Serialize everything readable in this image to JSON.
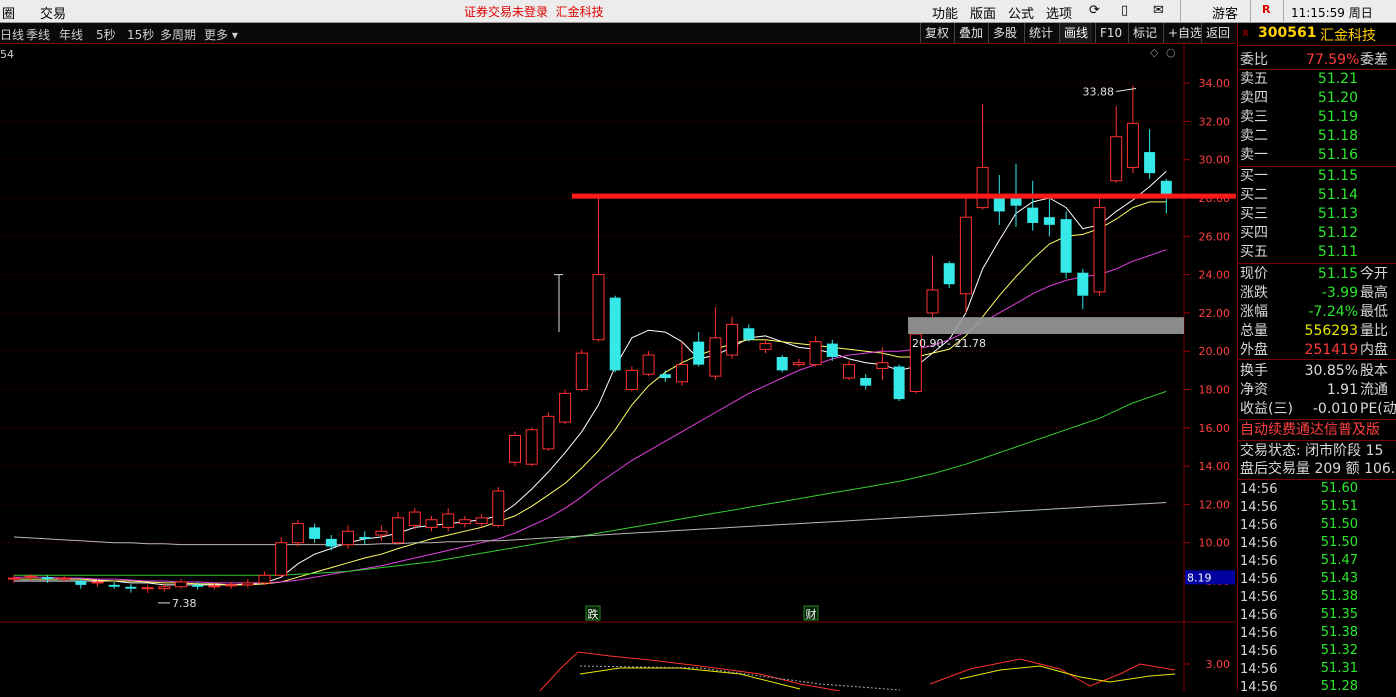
{
  "menubar": {
    "left_items": [
      "圈",
      "交易"
    ],
    "notice": "证券交易未登录",
    "stock_name": "汇金科技",
    "menus": [
      "功能",
      "版面",
      "公式",
      "选项"
    ],
    "user": "游客",
    "r_badge": "R",
    "time": "11:15:59",
    "weekday": "周日"
  },
  "toolbar": {
    "periods": [
      "日线",
      "季线",
      "年线",
      "5秒",
      "15秒",
      "多周期",
      "更多 ▾"
    ],
    "buttons": [
      "复权",
      "叠加",
      "多股",
      "统计",
      "画线",
      "F10",
      "标记",
      "+自选",
      "返回"
    ]
  },
  "chart": {
    "corner_label": "54",
    "max_label": "33.88",
    "min_label": "7.38",
    "zone_label": "20.90 - 21.78",
    "current_marker": "8.19",
    "sub_tick": "3.00",
    "event_markers": [
      {
        "label": "跌"
      },
      {
        "label": "财"
      }
    ]
  },
  "chart_data": {
    "type": "candlestick",
    "yticks": [
      8,
      10,
      12,
      14,
      16,
      18,
      20,
      22,
      24,
      26,
      28,
      30,
      32,
      34
    ],
    "ylim": [
      6.8,
      35
    ],
    "ytick_labels": [
      "8.00",
      "10.00",
      "12.00",
      "14.00",
      "16.00",
      "18.00",
      "20.00",
      "22.00",
      "24.00",
      "26.00",
      "28.00",
      "30.00",
      "32.00",
      "34.00"
    ],
    "candles": [
      {
        "o": 8.1,
        "c": 8.15,
        "h": 8.3,
        "l": 7.9
      },
      {
        "o": 8.2,
        "c": 8.25,
        "h": 8.35,
        "l": 8.0
      },
      {
        "o": 8.2,
        "c": 8.1,
        "h": 8.3,
        "l": 7.9
      },
      {
        "o": 8.1,
        "c": 8.15,
        "h": 8.25,
        "l": 7.95
      },
      {
        "o": 8.0,
        "c": 7.8,
        "h": 8.1,
        "l": 7.6
      },
      {
        "o": 7.9,
        "c": 7.95,
        "h": 8.05,
        "l": 7.7
      },
      {
        "o": 7.8,
        "c": 7.7,
        "h": 7.95,
        "l": 7.6
      },
      {
        "o": 7.7,
        "c": 7.6,
        "h": 7.85,
        "l": 7.4
      },
      {
        "o": 7.6,
        "c": 7.65,
        "h": 7.8,
        "l": 7.38
      },
      {
        "o": 7.6,
        "c": 7.7,
        "h": 7.85,
        "l": 7.45
      },
      {
        "o": 7.7,
        "c": 7.95,
        "h": 8.1,
        "l": 7.6
      },
      {
        "o": 7.8,
        "c": 7.7,
        "h": 7.95,
        "l": 7.55
      },
      {
        "o": 7.7,
        "c": 7.75,
        "h": 7.9,
        "l": 7.55
      },
      {
        "o": 7.75,
        "c": 7.8,
        "h": 7.95,
        "l": 7.6
      },
      {
        "o": 7.8,
        "c": 7.9,
        "h": 8.1,
        "l": 7.65
      },
      {
        "o": 7.9,
        "c": 8.3,
        "h": 8.5,
        "l": 7.8
      },
      {
        "o": 8.3,
        "c": 10.0,
        "h": 10.3,
        "l": 8.2
      },
      {
        "o": 10.0,
        "c": 11.0,
        "h": 11.2,
        "l": 9.8
      },
      {
        "o": 10.8,
        "c": 10.2,
        "h": 11.0,
        "l": 10.0
      },
      {
        "o": 10.2,
        "c": 9.8,
        "h": 10.4,
        "l": 9.6
      },
      {
        "o": 9.9,
        "c": 10.6,
        "h": 10.9,
        "l": 9.7
      },
      {
        "o": 10.3,
        "c": 10.2,
        "h": 10.6,
        "l": 9.9
      },
      {
        "o": 10.4,
        "c": 10.6,
        "h": 10.9,
        "l": 10.1
      },
      {
        "o": 10.0,
        "c": 11.3,
        "h": 11.6,
        "l": 9.9
      },
      {
        "o": 10.9,
        "c": 11.6,
        "h": 11.8,
        "l": 10.7
      },
      {
        "o": 10.8,
        "c": 11.2,
        "h": 11.4,
        "l": 10.6
      },
      {
        "o": 10.8,
        "c": 11.5,
        "h": 11.8,
        "l": 10.6
      },
      {
        "o": 11.0,
        "c": 11.2,
        "h": 11.4,
        "l": 10.8
      },
      {
        "o": 11.0,
        "c": 11.3,
        "h": 11.5,
        "l": 10.8
      },
      {
        "o": 10.9,
        "c": 12.7,
        "h": 12.9,
        "l": 10.8
      },
      {
        "o": 14.2,
        "c": 15.6,
        "h": 15.8,
        "l": 14.0
      },
      {
        "o": 14.1,
        "c": 15.9,
        "h": 16.0,
        "l": 14.0
      },
      {
        "o": 14.9,
        "c": 16.6,
        "h": 16.8,
        "l": 14.8
      },
      {
        "o": 16.3,
        "c": 17.8,
        "h": 18.0,
        "l": 16.2
      },
      {
        "o": 18.0,
        "c": 19.9,
        "h": 20.1,
        "l": 17.9
      },
      {
        "o": 20.6,
        "c": 24.0,
        "h": 28.0,
        "l": 20.5
      },
      {
        "o": 22.8,
        "c": 19.0,
        "h": 22.9,
        "l": 18.9
      },
      {
        "o": 18.0,
        "c": 19.0,
        "h": 19.2,
        "l": 17.9
      },
      {
        "o": 18.8,
        "c": 19.8,
        "h": 20.0,
        "l": 18.7
      },
      {
        "o": 18.8,
        "c": 18.6,
        "h": 19.0,
        "l": 18.4
      },
      {
        "o": 18.4,
        "c": 19.3,
        "h": 20.5,
        "l": 18.2
      },
      {
        "o": 20.5,
        "c": 19.3,
        "h": 21.0,
        "l": 19.2
      },
      {
        "o": 18.7,
        "c": 20.7,
        "h": 22.3,
        "l": 18.5
      },
      {
        "o": 19.8,
        "c": 21.4,
        "h": 21.8,
        "l": 19.6
      },
      {
        "o": 21.2,
        "c": 20.6,
        "h": 21.4,
        "l": 20.5
      },
      {
        "o": 20.1,
        "c": 20.4,
        "h": 20.6,
        "l": 19.9
      },
      {
        "o": 19.7,
        "c": 19.0,
        "h": 19.8,
        "l": 18.9
      },
      {
        "o": 19.3,
        "c": 19.4,
        "h": 19.6,
        "l": 19.2
      },
      {
        "o": 19.3,
        "c": 20.5,
        "h": 20.8,
        "l": 19.2
      },
      {
        "o": 20.4,
        "c": 19.7,
        "h": 20.6,
        "l": 19.5
      },
      {
        "o": 18.6,
        "c": 19.3,
        "h": 19.5,
        "l": 18.5
      },
      {
        "o": 18.6,
        "c": 18.2,
        "h": 18.8,
        "l": 18.0
      },
      {
        "o": 19.1,
        "c": 19.4,
        "h": 20.2,
        "l": 18.5
      },
      {
        "o": 19.2,
        "c": 17.5,
        "h": 19.3,
        "l": 17.4
      },
      {
        "o": 17.9,
        "c": 20.9,
        "h": 21.0,
        "l": 17.8
      },
      {
        "o": 22.0,
        "c": 23.2,
        "h": 25.0,
        "l": 21.8
      },
      {
        "o": 24.6,
        "c": 23.5,
        "h": 24.7,
        "l": 23.3
      },
      {
        "o": 23.0,
        "c": 27.0,
        "h": 28.1,
        "l": 22.0
      },
      {
        "o": 27.5,
        "c": 29.6,
        "h": 32.9,
        "l": 27.4
      },
      {
        "o": 28.1,
        "c": 27.3,
        "h": 29.2,
        "l": 26.6
      },
      {
        "o": 28.1,
        "c": 27.6,
        "h": 29.8,
        "l": 26.5
      },
      {
        "o": 27.5,
        "c": 26.7,
        "h": 28.9,
        "l": 26.3
      },
      {
        "o": 27.0,
        "c": 26.6,
        "h": 28.2,
        "l": 26.0
      },
      {
        "o": 26.9,
        "c": 24.1,
        "h": 27.3,
        "l": 23.8
      },
      {
        "o": 24.1,
        "c": 22.9,
        "h": 24.3,
        "l": 22.2
      },
      {
        "o": 23.1,
        "c": 27.5,
        "h": 28.1,
        "l": 22.9
      },
      {
        "o": 28.9,
        "c": 31.2,
        "h": 32.8,
        "l": 28.8
      },
      {
        "o": 29.6,
        "c": 31.9,
        "h": 33.88,
        "l": 29.3
      },
      {
        "o": 30.4,
        "c": 29.3,
        "h": 31.6,
        "l": 29.0
      },
      {
        "o": 28.9,
        "c": 28.1,
        "h": 29.0,
        "l": 27.2
      }
    ],
    "resistance_level": 28.1,
    "zone": [
      20.9,
      21.78
    ],
    "ma_lines": [
      {
        "color": "#ffffff",
        "values": [
          8.0,
          8.0,
          8.0,
          8.0,
          8.0,
          8.0,
          8.0,
          7.9,
          7.9,
          7.8,
          7.8,
          7.8,
          7.8,
          7.8,
          7.85,
          7.9,
          8.2,
          8.9,
          9.4,
          9.7,
          10.0,
          10.2,
          10.3,
          10.5,
          10.8,
          10.9,
          11.0,
          11.1,
          11.2,
          11.4,
          12.0,
          12.8,
          13.7,
          14.7,
          15.8,
          17.2,
          19.2,
          20.7,
          21.1,
          21.0,
          20.5,
          19.6,
          19.8,
          20.2,
          20.7,
          20.8,
          20.5,
          20.2,
          20.1,
          19.9,
          19.6,
          19.4,
          19.3,
          19.0,
          19.2,
          19.9,
          20.6,
          22.0,
          24.3,
          25.8,
          27.2,
          27.8,
          28.0,
          27.5,
          26.4,
          26.6,
          27.3,
          27.9,
          28.6,
          29.4
        ]
      },
      {
        "color": "#ffff66",
        "values": [
          8.1,
          8.1,
          8.1,
          8.1,
          8.1,
          8.05,
          8.0,
          8.0,
          7.95,
          7.9,
          7.9,
          7.85,
          7.85,
          7.8,
          7.8,
          7.85,
          7.95,
          8.2,
          8.45,
          8.7,
          8.95,
          9.2,
          9.4,
          9.7,
          9.95,
          10.2,
          10.4,
          10.6,
          10.8,
          11.1,
          11.4,
          11.9,
          12.5,
          13.1,
          13.9,
          14.8,
          15.9,
          17.2,
          18.2,
          18.9,
          19.4,
          19.8,
          20.1,
          20.4,
          20.6,
          20.6,
          20.5,
          20.4,
          20.3,
          20.2,
          20.1,
          20.0,
          19.9,
          19.7,
          19.7,
          19.9,
          20.1,
          20.8,
          21.8,
          22.9,
          23.9,
          24.8,
          25.6,
          26.0,
          26.1,
          26.4,
          26.9,
          27.5,
          27.8,
          27.8
        ]
      },
      {
        "color": "#e040e0",
        "values": [
          8.2,
          8.2,
          8.2,
          8.15,
          8.15,
          8.1,
          8.1,
          8.05,
          8.0,
          8.0,
          7.95,
          7.95,
          7.9,
          7.9,
          7.9,
          7.9,
          7.95,
          8.05,
          8.2,
          8.35,
          8.5,
          8.65,
          8.8,
          9.0,
          9.2,
          9.4,
          9.6,
          9.8,
          10.0,
          10.2,
          10.5,
          10.9,
          11.3,
          11.8,
          12.4,
          13.1,
          13.7,
          14.3,
          14.8,
          15.3,
          15.8,
          16.3,
          16.8,
          17.3,
          17.8,
          18.2,
          18.6,
          19.0,
          19.3,
          19.6,
          19.8,
          19.9,
          20.0,
          20.0,
          20.1,
          20.3,
          20.6,
          21.0,
          21.5,
          22.0,
          22.5,
          23.0,
          23.4,
          23.7,
          23.9,
          24.0,
          24.3,
          24.7,
          25.0,
          25.3
        ]
      },
      {
        "color": "#33cc33",
        "values": [
          8.3,
          8.3,
          8.3,
          8.3,
          8.3,
          8.3,
          8.3,
          8.3,
          8.3,
          8.3,
          8.3,
          8.3,
          8.3,
          8.3,
          8.3,
          8.3,
          8.3,
          8.35,
          8.4,
          8.45,
          8.5,
          8.6,
          8.7,
          8.8,
          8.9,
          9.0,
          9.15,
          9.3,
          9.45,
          9.6,
          9.75,
          9.9,
          10.05,
          10.2,
          10.35,
          10.5,
          10.65,
          10.8,
          10.95,
          11.1,
          11.25,
          11.4,
          11.55,
          11.7,
          11.85,
          12.0,
          12.15,
          12.3,
          12.45,
          12.6,
          12.75,
          12.9,
          13.05,
          13.2,
          13.4,
          13.6,
          13.85,
          14.1,
          14.4,
          14.7,
          15.0,
          15.3,
          15.6,
          15.9,
          16.2,
          16.5,
          16.9,
          17.3,
          17.6,
          17.9
        ]
      },
      {
        "color": "#b8b8b8",
        "values": [
          10.3,
          10.25,
          10.2,
          10.15,
          10.1,
          10.05,
          10.0,
          10.0,
          9.95,
          9.95,
          9.9,
          9.9,
          9.9,
          9.9,
          9.9,
          9.9,
          9.9,
          9.9,
          9.9,
          9.9,
          9.9,
          9.9,
          9.95,
          9.95,
          10.0,
          10.0,
          10.05,
          10.05,
          10.1,
          10.1,
          10.15,
          10.2,
          10.25,
          10.3,
          10.35,
          10.4,
          10.45,
          10.5,
          10.55,
          10.6,
          10.65,
          10.7,
          10.75,
          10.8,
          10.85,
          10.9,
          10.95,
          11.0,
          11.05,
          11.1,
          11.15,
          11.2,
          11.25,
          11.3,
          11.35,
          11.4,
          11.45,
          11.5,
          11.55,
          11.6,
          11.65,
          11.7,
          11.75,
          11.8,
          11.85,
          11.9,
          11.95,
          12.0,
          12.05,
          12.1
        ]
      }
    ],
    "sub_ylim": [
      0,
      5
    ]
  },
  "quote": {
    "code": "300561",
    "name": "汇金科技",
    "ratio_label": "委比",
    "ratio_value": "77.59%",
    "diff_label": "委差",
    "asks": [
      {
        "label": "卖五",
        "price": "51.21"
      },
      {
        "label": "卖四",
        "price": "51.20"
      },
      {
        "label": "卖三",
        "price": "51.19"
      },
      {
        "label": "卖二",
        "price": "51.18"
      },
      {
        "label": "卖一",
        "price": "51.16"
      }
    ],
    "bids": [
      {
        "label": "买一",
        "price": "51.15"
      },
      {
        "label": "买二",
        "price": "51.14"
      },
      {
        "label": "买三",
        "price": "51.13"
      },
      {
        "label": "买四",
        "price": "51.12"
      },
      {
        "label": "买五",
        "price": "51.11"
      }
    ],
    "stats": [
      {
        "label": "现价",
        "value": "51.15",
        "color": "g",
        "label2": "今开"
      },
      {
        "label": "涨跌",
        "value": "-3.99",
        "color": "g",
        "label2": "最高"
      },
      {
        "label": "涨幅",
        "value": "-7.24%",
        "color": "g",
        "label2": "最低"
      },
      {
        "label": "总量",
        "value": "556293",
        "color": "y",
        "label2": "量比"
      },
      {
        "label": "外盘",
        "value": "251419",
        "color": "r",
        "label2": "内盘"
      },
      {
        "label": "换手",
        "value": "30.85%",
        "color": "w",
        "label2": "股本"
      },
      {
        "label": "净资",
        "value": "1.91",
        "color": "w",
        "label2": "流通"
      },
      {
        "label": "收益(三)",
        "value": "-0.010",
        "color": "w",
        "label2": "PE(动"
      }
    ],
    "banner": "自动续费通达信普及版",
    "trade_state": "交易状态: 闭市阶段 15",
    "after_hours": "盘后交易量 209 额 106.",
    "ticks": [
      {
        "time": "14:56",
        "price": "51.60"
      },
      {
        "time": "14:56",
        "price": "51.51"
      },
      {
        "time": "14:56",
        "price": "51.50"
      },
      {
        "time": "14:56",
        "price": "51.50"
      },
      {
        "time": "14:56",
        "price": "51.47"
      },
      {
        "time": "14:56",
        "price": "51.43"
      },
      {
        "time": "14:56",
        "price": "51.38"
      },
      {
        "time": "14:56",
        "price": "51.35"
      },
      {
        "time": "14:56",
        "price": "51.38"
      },
      {
        "time": "14:56",
        "price": "51.32"
      },
      {
        "time": "14:56",
        "price": "51.31"
      },
      {
        "time": "14:56",
        "price": "51.28"
      }
    ]
  }
}
